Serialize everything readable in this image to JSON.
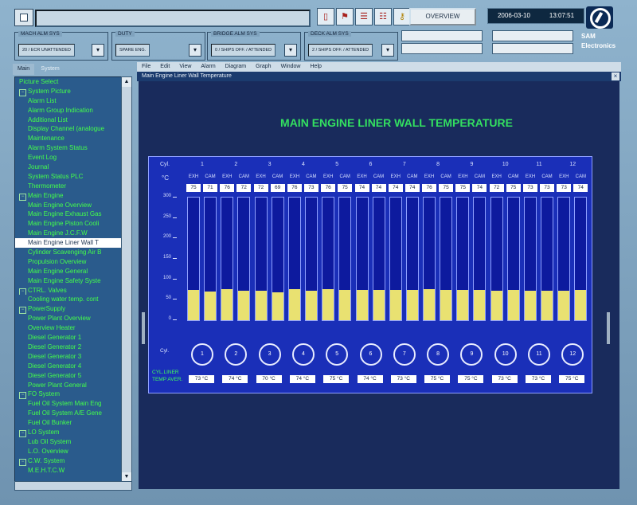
{
  "toolbar": {
    "overview_label": "OVERVIEW",
    "date": "2006-03-10",
    "time": "13:07:51",
    "icons": [
      "blank-icon",
      "flag-icon",
      "report-icon",
      "report2-icon",
      "key-icon"
    ]
  },
  "alarms": {
    "mach_title": "MACH ALM SYS",
    "mach_value": "20 / ECR UNATTENDED",
    "duty_title": "DUTY",
    "duty_value": "SPARE ENG.",
    "bridge_title": "BRIDGE ALM SYS",
    "bridge_value": "0 / SHIPS OFF. / ATTENDED",
    "deck_title": "DECK ALM SYS",
    "deck_value": "2 / SHIPS OFF. / ATTENDED"
  },
  "brand": {
    "line1": "SAM",
    "line2": "Electronics"
  },
  "tabs": [
    "Main",
    "System"
  ],
  "tree": [
    {
      "label": "Picture Select",
      "level": 0,
      "expander": false
    },
    {
      "label": "System Picture",
      "level": 0,
      "expander": true
    },
    {
      "label": "Alarm List",
      "level": 1
    },
    {
      "label": "Alarm Group Indication",
      "level": 1
    },
    {
      "label": "Additional List",
      "level": 1
    },
    {
      "label": "Display Channel (analogue",
      "level": 1
    },
    {
      "label": "Maintenance",
      "level": 1
    },
    {
      "label": "Alarm System Status",
      "level": 1
    },
    {
      "label": "Event Log",
      "level": 1
    },
    {
      "label": "Journal",
      "level": 1
    },
    {
      "label": "System Status PLC",
      "level": 1
    },
    {
      "label": "Thermometer",
      "level": 1
    },
    {
      "label": "Main Engine",
      "level": 0,
      "expander": true
    },
    {
      "label": "Main Engine Overview",
      "level": 1
    },
    {
      "label": "Main Engine Exhaust Gas",
      "level": 1
    },
    {
      "label": "Main Engine Piston Cooli",
      "level": 1
    },
    {
      "label": "Main Engine J.C.F.W",
      "level": 1
    },
    {
      "label": "Main Engine Liner Wall T",
      "level": 1,
      "selected": true
    },
    {
      "label": "Cylinder Scavenging Air B",
      "level": 1
    },
    {
      "label": "Propulsion Overview",
      "level": 1
    },
    {
      "label": "Main Engine General",
      "level": 1
    },
    {
      "label": "Main Engine Safety Syste",
      "level": 1
    },
    {
      "label": "CTRL. Valves",
      "level": 0,
      "expander": true
    },
    {
      "label": "Cooling water temp. cont",
      "level": 1
    },
    {
      "label": "PowerSupply",
      "level": 0,
      "expander": true
    },
    {
      "label": "Power Plant Overview",
      "level": 1
    },
    {
      "label": "Overview Heater",
      "level": 1
    },
    {
      "label": "Diesel Generator 1",
      "level": 1
    },
    {
      "label": "Diesel Generator 2",
      "level": 1
    },
    {
      "label": "Diesel Generator 3",
      "level": 1
    },
    {
      "label": "Diesel Generator 4",
      "level": 1
    },
    {
      "label": "Diesel Generator 5",
      "level": 1
    },
    {
      "label": "Power Plant General",
      "level": 1
    },
    {
      "label": "FO System",
      "level": 0,
      "expander": true
    },
    {
      "label": "Fuel Oil System Main Eng",
      "level": 1
    },
    {
      "label": "Fuel Oil System A/E Gene",
      "level": 1
    },
    {
      "label": "Fuel Oil Bunker",
      "level": 1
    },
    {
      "label": "LO System",
      "level": 0,
      "expander": true
    },
    {
      "label": "Lub Oil System",
      "level": 1
    },
    {
      "label": "L.O. Overview",
      "level": 1
    },
    {
      "label": "C.W. System",
      "level": 0,
      "expander": true
    },
    {
      "label": "M.E.H.T.C.W",
      "level": 1
    }
  ],
  "menu": [
    "File",
    "Edit",
    "View",
    "Alarm",
    "Diagram",
    "Graph",
    "Window",
    "Help"
  ],
  "window_title": "Main Engine Liner Wall Temperature",
  "screen": {
    "title": "MAIN ENGINE LINER WALL TEMPERATURE",
    "cyl_label": "Cyl.",
    "unit": "°C",
    "exh_label": "EXH",
    "cam_label": "CAM",
    "cyl_bottom_label": "Cyl.",
    "avg_label": "CYL.LINER TEMP AVER.",
    "axis_ticks": [
      "300",
      "250",
      "200",
      "150",
      "100",
      "50",
      "0"
    ],
    "cylinders": [
      "1",
      "2",
      "3",
      "4",
      "5",
      "6",
      "7",
      "8",
      "9",
      "10",
      "11",
      "12"
    ],
    "exh_values": [
      75,
      76,
      72,
      76,
      76,
      74,
      74,
      76,
      75,
      72,
      73,
      73
    ],
    "cam_values": [
      71,
      72,
      69,
      73,
      75,
      74,
      74,
      75,
      74,
      75,
      73,
      74
    ],
    "averages": [
      "73 °C",
      "74 °C",
      "70 °C",
      "74 °C",
      "75 °C",
      "74 °C",
      "73 °C",
      "75 °C",
      "75 °C",
      "73 °C",
      "73 °C",
      "75 °C"
    ],
    "axis_max": 300
  }
}
